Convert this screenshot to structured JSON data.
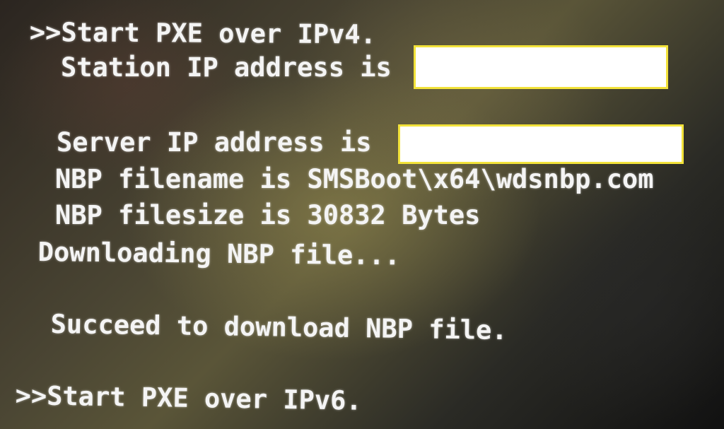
{
  "console": {
    "lines": [
      ">>Start PXE over IPv4.",
      "Station IP address is",
      "Server IP address is",
      "NBP filename is SMSBoot\\x64\\wdsnbp.com",
      "NBP filesize is 30832 Bytes",
      "Downloading NBP file...",
      "Succeed to download NBP file.",
      ">>Start PXE over IPv6."
    ]
  },
  "colors": {
    "text": "#f4f4f4",
    "redaction_fill": "#ffffff",
    "redaction_border": "#f2e23a"
  }
}
